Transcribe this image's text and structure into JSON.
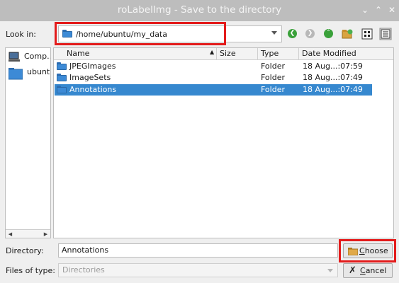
{
  "window": {
    "title": "roLabelImg - Save to the directory"
  },
  "look_in": {
    "label": "Look in:",
    "path": "/home/ubuntu/my_data"
  },
  "toolbar": {
    "icons": [
      "back-icon",
      "forward-icon",
      "parent-directory-icon",
      "new-folder-icon",
      "list-view-icon",
      "detail-view-icon"
    ]
  },
  "sidebar": {
    "items": [
      {
        "label": "Comp...",
        "icon": "computer-icon"
      },
      {
        "label": "ubuntu",
        "icon": "folder-icon"
      }
    ]
  },
  "columns": [
    "Name",
    "Size",
    "Type",
    "Date Modified"
  ],
  "files": [
    {
      "name": "JPEGImages",
      "size": "",
      "type": "Folder",
      "modified": "18 Aug...:07:59",
      "selected": false
    },
    {
      "name": "ImageSets",
      "size": "",
      "type": "Folder",
      "modified": "18 Aug...:07:49",
      "selected": false
    },
    {
      "name": "Annotations",
      "size": "",
      "type": "Folder",
      "modified": "18 Aug...:07:49",
      "selected": true
    }
  ],
  "directory": {
    "label": "Directory:",
    "value": "Annotations"
  },
  "file_type": {
    "label": "Files of type:",
    "value": "Directories"
  },
  "buttons": {
    "choose_prefix": "",
    "choose_mnemonic": "C",
    "choose_rest": "hoose",
    "cancel_prefix": "",
    "cancel_mnemonic": "C",
    "cancel_rest": "ancel"
  },
  "colors": {
    "title_bar": "#bdbdbd",
    "selection": "#3688cf",
    "folder": "#3c8ad6",
    "highlight_box": "#e31b1b"
  }
}
